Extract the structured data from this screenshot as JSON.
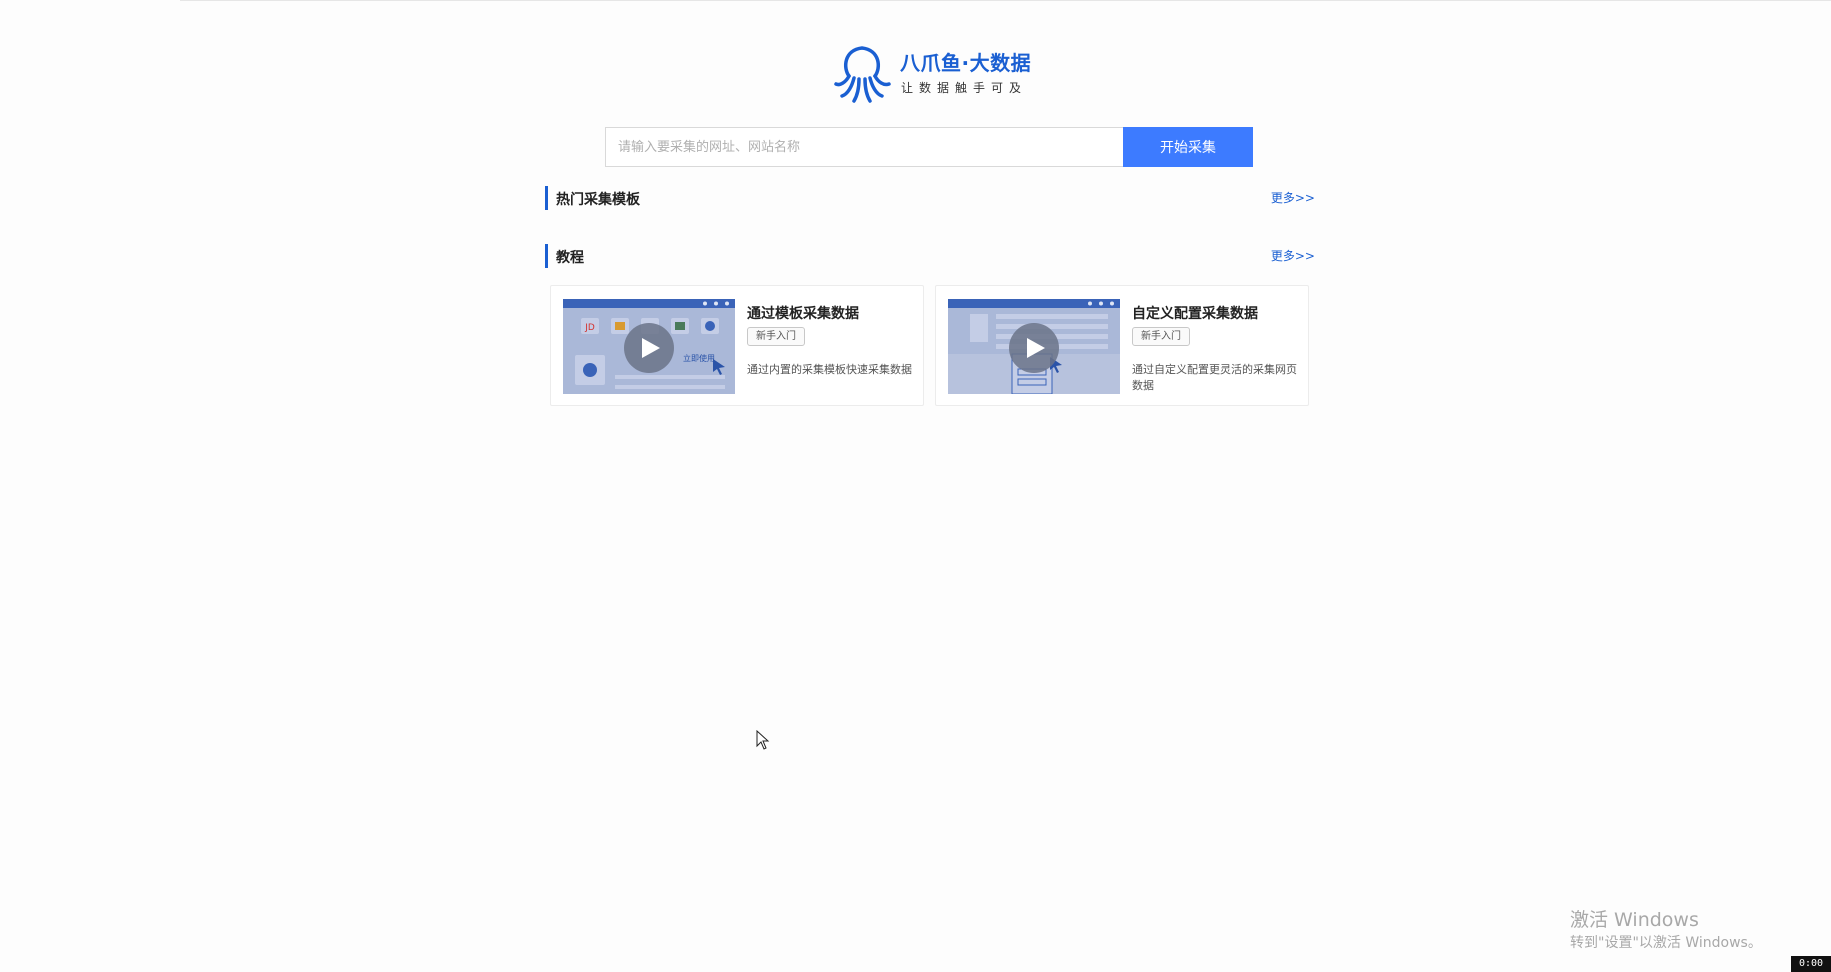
{
  "brand": {
    "name": "八爪鱼·大数据",
    "slogan": "让数据触手可及",
    "color": "#1a5fd2"
  },
  "search": {
    "value": "",
    "placeholder": "请输入要采集的网址、网站名称",
    "button_label": "开始采集",
    "button_color": "#3d7bff"
  },
  "sections": {
    "templates": {
      "title": "热门采集模板",
      "more_label": "更多>>"
    },
    "tutorials": {
      "title": "教程",
      "more_label": "更多>>",
      "cards": [
        {
          "title": "通过模板采集数据",
          "tag": "新手入门",
          "description": "通过内置的采集模板快速采集数据",
          "thumb_label": "立即使用",
          "thumb_logo": "JD"
        },
        {
          "title": "自定义配置采集数据",
          "tag": "新手入门",
          "description": "通过自定义配置更灵活的采集网页数据"
        }
      ]
    }
  },
  "watermark": {
    "title": "激活 Windows",
    "subtitle": "转到\"设置\"以激活 Windows。"
  },
  "clock": "0:00"
}
